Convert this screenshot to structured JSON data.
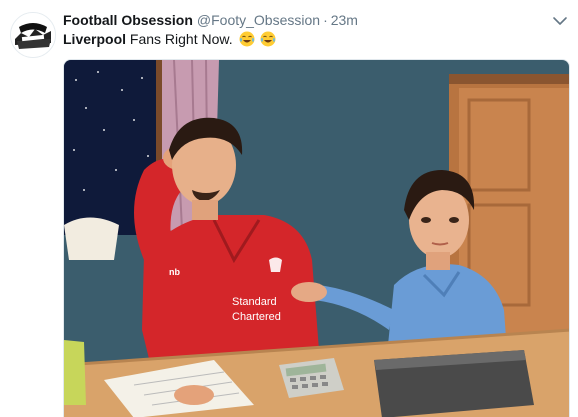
{
  "tweet": {
    "display_name": "Football Obsession",
    "handle": "@Footy_Obsession",
    "separator": "·",
    "time": "23m",
    "text_bold": "Liverpool",
    "text_rest": " Fans Right Now.",
    "emojis": [
      "tears-of-joy-emoji",
      "tears-of-joy-emoji"
    ]
  },
  "image": {
    "shirt_sponsor_line1": "Standard",
    "shirt_sponsor_line2": "Chartered",
    "shirt_brand": "nb"
  },
  "colors": {
    "name": "#14171a",
    "meta": "#657786",
    "shirt": "#d4262a",
    "wall": "#3c6070",
    "boy_shirt": "#6a9cd6",
    "door": "#c9844e",
    "desk": "#d9a36a"
  }
}
